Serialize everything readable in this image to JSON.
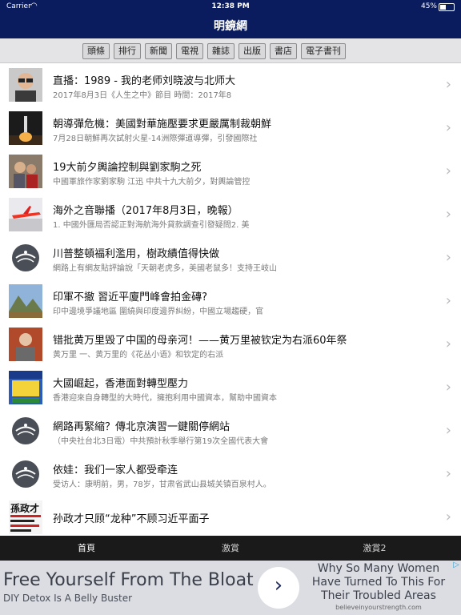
{
  "status_bar": {
    "carrier": "Carrier",
    "time": "12:38 PM",
    "battery": "45%",
    "battery_level": 0.45
  },
  "nav": {
    "title": "明鏡網"
  },
  "categories": [
    "頭條",
    "排行",
    "新聞",
    "電視",
    "雜誌",
    "出版",
    "書店",
    "電子書刊"
  ],
  "articles": [
    {
      "title": "直播：1989 - 我的老师刘晓波与北师大",
      "subtitle": "2017年8月3日《人生之中》節目 時間：2017年8",
      "thumb": "portrait-glasses"
    },
    {
      "title": "朝導彈危機：美國對華施壓要求更嚴厲制裁朝鮮",
      "subtitle": "7月28日朝鮮再次試射火星-14洲際彈道導彈，引發國際社",
      "thumb": "missile-launch"
    },
    {
      "title": "19大前夕輿論控制與劉家駒之死",
      "subtitle": "中國軍旅作家劉家駒 江迅 中共十九大前夕，對輿論管控",
      "thumb": "men-photo"
    },
    {
      "title": "海外之音聯播（2017年8月3日，晚報）",
      "subtitle": "1. 中國外匯局否認正對海航海外貸款調查引發疑問2. 美",
      "thumb": "airplane"
    },
    {
      "title": "川普整頓福利濫用，樹政績值得快做",
      "subtitle": "網路上有網友貼評論說「天朝老虎多，美國老鼠多！支持王岐山",
      "thumb": "mirror-logo"
    },
    {
      "title": "印軍不撤 習近平廈門峰會拍金磚?",
      "subtitle": "印中邊境爭議地區 圍繞與印度邊界糾紛，中國立場趨硬，官",
      "thumb": "mountains"
    },
    {
      "title": "错批黄万里毁了中国的母亲河！——黄万里被钦定为右派60年祭",
      "subtitle": "黄万里 一、黄万里的《花丛小语》和钦定的右派",
      "thumb": "elder-portrait"
    },
    {
      "title": "大國崛起，香港面對轉型壓力",
      "subtitle": "香港迎來自身轉型的大時代，擁抱利用中國資本，幫助中國資本",
      "thumb": "magazine-cover"
    },
    {
      "title": "網路再緊縮？傳北京演習一鍵關停網站",
      "subtitle": "（中央社台北3日電）中共預計秋季舉行第19次全國代表大會",
      "thumb": "mirror-logo"
    },
    {
      "title": "依娃：我们一家人都受牵连",
      "subtitle": "受访人：康明前，男，78岁，甘肃省武山县城关镇百泉村人。",
      "thumb": "mirror-logo"
    },
    {
      "title": "孙政才只顾“龙种”不顾习近平面子",
      "subtitle": "",
      "thumb": "newspaper-headline",
      "thumb_text": "孫政才"
    }
  ],
  "tabs": [
    {
      "label": "首頁",
      "active": true
    },
    {
      "label": "激賞",
      "active": false
    },
    {
      "label": "激賞2",
      "active": false
    }
  ],
  "ad": {
    "headline": "Free Yourself From The Bloat",
    "subline": "DIY Detox Is A Belly Buster",
    "right_text": "Why So Many Women Have Turned To This For Their Troubled Areas",
    "url": "believeinyourstrength.com"
  },
  "colors": {
    "nav": "#0b1c5e",
    "tabbar": "#1a1a1a",
    "ad_bg": "#dcdde3"
  }
}
